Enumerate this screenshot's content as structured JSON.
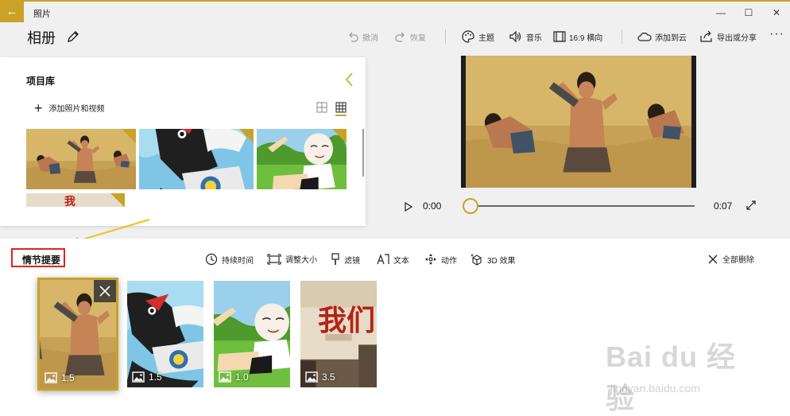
{
  "window": {
    "app_title": "照片",
    "back_glyph": "←",
    "minimize_glyph": "—",
    "maximize_glyph": "☐",
    "close_glyph": "✕"
  },
  "header": {
    "album_title": "相册",
    "commands": {
      "undo": "撤消",
      "redo": "恢复",
      "theme": "主题",
      "music": "音乐",
      "aspect": "16:9 横向",
      "add_to_cloud": "添加到云",
      "export_share": "导出或分享"
    },
    "more_glyph": "···"
  },
  "library": {
    "title": "项目库",
    "add_label": "添加照片和视频",
    "add_glyph": "+"
  },
  "player": {
    "current_time": "0:00",
    "total_time": "0:07",
    "position_fraction": 0
  },
  "storyboard": {
    "title": "情节提要",
    "tools": {
      "duration": "持续时间",
      "resize": "调整大小",
      "filter": "滤镜",
      "text": "文本",
      "motion": "动作",
      "effects_3d": "3D 效果",
      "remove_all": "全部删除"
    },
    "clips": [
      {
        "duration": "1.5",
        "selected": true
      },
      {
        "duration": "1.5",
        "selected": false
      },
      {
        "duration": "1.0",
        "selected": false
      },
      {
        "duration": "3.5",
        "selected": false
      }
    ]
  },
  "image_text": {
    "banner_chars": "我们"
  },
  "watermark": {
    "brand": "Bai du 经验",
    "url": "jingyan.baidu.com"
  },
  "colors": {
    "accent": "#c9a227",
    "highlight_border": "#d9261c",
    "annotation_arrow": "#f0c020"
  }
}
